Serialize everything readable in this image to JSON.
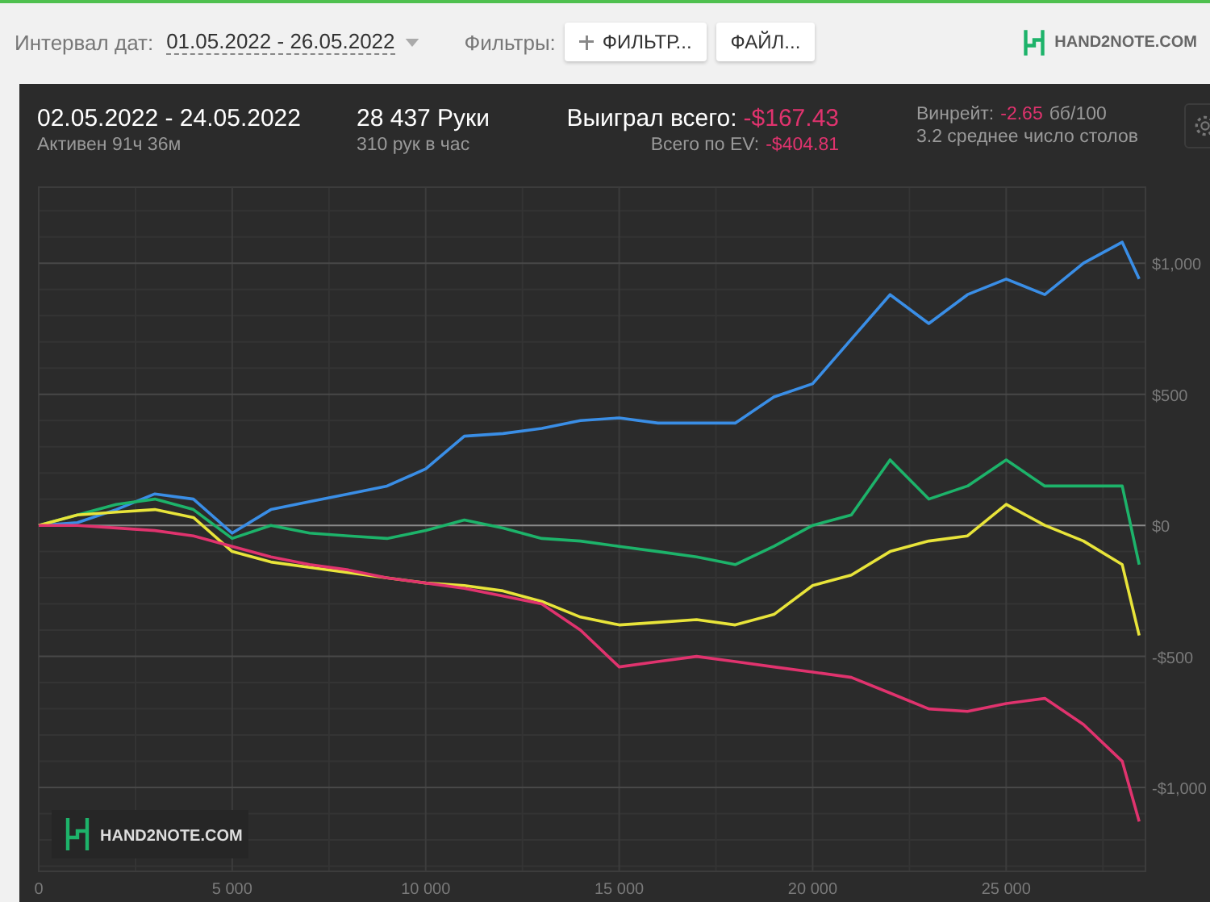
{
  "toolbar": {
    "date_label": "Интервал дат:",
    "date_range": "01.05.2022 - 26.05.2022",
    "filters_label": "Фильтры:",
    "buttons": [
      {
        "label": "ФИЛЬТР...",
        "kind": "add"
      },
      {
        "label": "ФАЙЛ...",
        "kind": "plain"
      }
    ],
    "logo": "HAND2NOTE.COM"
  },
  "summary": {
    "period": "02.05.2022 - 24.05.2022",
    "active": "Активен 91ч 36м",
    "hands": "28 437 Руки",
    "hands_per_hour": "310 рук в час",
    "won_label": "Выиграл всего:",
    "won_value": "-$167.43",
    "ev_label": "Всего по EV:",
    "ev_value": "-$404.81",
    "winrate_label": "Винрейт:",
    "winrate_value": "-2.65",
    "winrate_unit": "бб/100",
    "tables": "3.2 среднее число столов"
  },
  "chart": {
    "watermark": "HAND2NOTE.COM",
    "chart_data": {
      "type": "line",
      "x": [
        0,
        1000,
        2000,
        3000,
        4000,
        5000,
        6000,
        7000,
        8000,
        9000,
        10000,
        11000,
        12000,
        13000,
        14000,
        15000,
        16000,
        17000,
        18000,
        19000,
        20000,
        21000,
        22000,
        23000,
        24000,
        25000,
        26000,
        27000,
        28000,
        28437
      ],
      "grid": true,
      "xlim": [
        0,
        28600
      ],
      "ylim": [
        -1320,
        1290
      ],
      "xticks": [
        {
          "value": 0,
          "label": "0"
        },
        {
          "value": 5000,
          "label": "5 000"
        },
        {
          "value": 10000,
          "label": "10 000"
        },
        {
          "value": 15000,
          "label": "15 000"
        },
        {
          "value": 20000,
          "label": "20 000"
        },
        {
          "value": 25000,
          "label": "25 000"
        }
      ],
      "yticks": [
        {
          "value": 1000,
          "label": "$1,000"
        },
        {
          "value": 500,
          "label": "$500"
        },
        {
          "value": 0,
          "label": "$0"
        },
        {
          "value": -500,
          "label": "-$500"
        },
        {
          "value": -1000,
          "label": "-$1,000"
        }
      ],
      "series": [
        {
          "color": "#3a8ee6",
          "values": [
            0,
            10,
            60,
            120,
            100,
            -30,
            60,
            90,
            120,
            150,
            215,
            340,
            350,
            370,
            400,
            410,
            390,
            390,
            390,
            490,
            540,
            710,
            880,
            770,
            880,
            940,
            880,
            1000,
            1080,
            940
          ]
        },
        {
          "color": "#1db36a",
          "values": [
            0,
            40,
            80,
            100,
            60,
            -50,
            0,
            -30,
            -40,
            -50,
            -20,
            20,
            -10,
            -50,
            -60,
            -80,
            -100,
            -120,
            -150,
            -80,
            0,
            40,
            250,
            100,
            150,
            250,
            150,
            150,
            150,
            -150
          ]
        },
        {
          "color": "#e8e43a",
          "values": [
            0,
            40,
            50,
            60,
            30,
            -100,
            -140,
            -160,
            -180,
            -200,
            -220,
            -230,
            -250,
            -290,
            -350,
            -380,
            -370,
            -360,
            -380,
            -340,
            -230,
            -190,
            -100,
            -60,
            -40,
            80,
            0,
            -60,
            -150,
            -420
          ]
        },
        {
          "color": "#e0336e",
          "values": [
            0,
            0,
            -10,
            -20,
            -40,
            -80,
            -120,
            -150,
            -170,
            -200,
            -220,
            -240,
            -270,
            -300,
            -400,
            -540,
            -520,
            -500,
            -520,
            -540,
            -560,
            -580,
            -640,
            -700,
            -710,
            -680,
            -660,
            -760,
            -900,
            -1130
          ]
        }
      ]
    }
  }
}
